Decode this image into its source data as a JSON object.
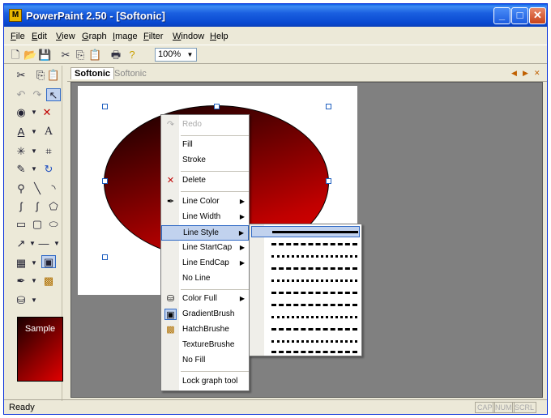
{
  "window": {
    "title": "PowerPaint 2.50 - [Softonic]",
    "app_icon": "M"
  },
  "menubar": {
    "items": [
      {
        "first": "F",
        "rest": "ile"
      },
      {
        "first": "E",
        "rest": "dit"
      },
      {
        "first": "V",
        "rest": "iew"
      },
      {
        "first": "G",
        "rest": "raph"
      },
      {
        "first": "I",
        "rest": "mage"
      },
      {
        "first": "F",
        "rest": "ilter"
      },
      {
        "first": "W",
        "rest": "indow"
      },
      {
        "first": "H",
        "rest": "elp"
      }
    ]
  },
  "toolbar": {
    "zoom_value": "100%",
    "icons": [
      "new-file-icon",
      "open-folder-icon",
      "save-icon",
      "cut-icon",
      "copy-icon",
      "paste-icon",
      "print-icon",
      "help-icon"
    ]
  },
  "tabs": {
    "active": "Softonic",
    "inactive": "Softonic"
  },
  "leftbar": {
    "sample_label": "Sample"
  },
  "context_menu": {
    "items": [
      {
        "label": "Redo",
        "u": "",
        "disabled": true
      },
      {
        "label": "Fill"
      },
      {
        "label": "Stroke"
      },
      {
        "label": "Delete"
      },
      {
        "label": "Line Color"
      },
      {
        "label": "Line Width"
      },
      {
        "label": "Line Style"
      },
      {
        "label": "Line StartCap"
      },
      {
        "label": "Line EndCap"
      },
      {
        "label": "No Line"
      },
      {
        "label": "Color Full"
      },
      {
        "label": "GradientBrush"
      },
      {
        "label": "HatchBrushe"
      },
      {
        "label": "TextureBrushe"
      },
      {
        "label": "No Fill"
      },
      {
        "label": "Lock graph tool"
      }
    ]
  },
  "line_styles": [
    "solid",
    "dash",
    "dot",
    "dash-dot",
    "dash-dot-dot",
    "long-dash",
    "dash-dot",
    "long-dash-dot",
    "dash-dot-dot",
    "dash-dot",
    "long-dash-dot"
  ],
  "statusbar": {
    "text": "Ready",
    "indicators": [
      "CAP",
      "NUM",
      "SCRL"
    ]
  },
  "colors": {
    "titlebar": "#0a5ce6",
    "highlight": "#c1d2ee",
    "workspace": "#808080",
    "ellipse": "#c00000"
  }
}
